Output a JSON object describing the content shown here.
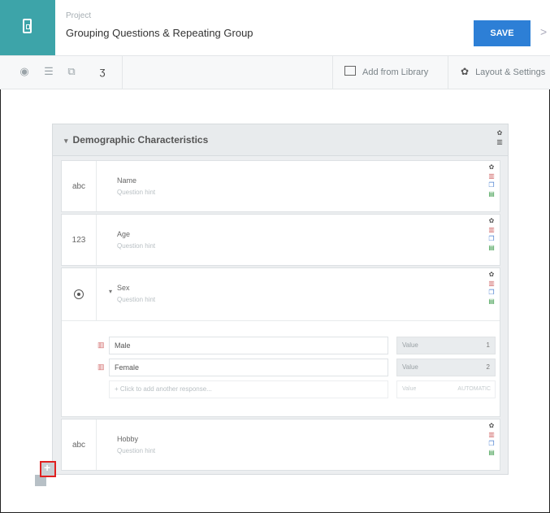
{
  "header": {
    "project_label": "Project",
    "project_title": "Grouping Questions & Repeating Group",
    "save_label": "SAVE",
    "close_glyph": ">"
  },
  "toolbar": {
    "add_from_library": "Add from Library",
    "layout_settings": "Layout & Settings"
  },
  "group": {
    "title": "Demographic Characteristics",
    "questions": [
      {
        "type_label": "abc",
        "label": "Name",
        "hint": "Question hint"
      },
      {
        "type_label": "123",
        "label": "Age",
        "hint": "Question hint"
      },
      {
        "type_label": "radio",
        "label": "Sex",
        "hint": "Question hint",
        "responses": [
          {
            "label": "Male",
            "value_label": "Value",
            "value": "1"
          },
          {
            "label": "Female",
            "value_label": "Value",
            "value": "2"
          }
        ],
        "add_response": "+ Click to add another response...",
        "add_value_label": "Value",
        "add_value_auto": "AUTOMATIC"
      },
      {
        "type_label": "abc",
        "label": "Hobby",
        "hint": "Question hint"
      }
    ]
  },
  "colors": {
    "accent": "#3da4a9",
    "save": "#2d7fd6",
    "highlight": "#e02020"
  }
}
